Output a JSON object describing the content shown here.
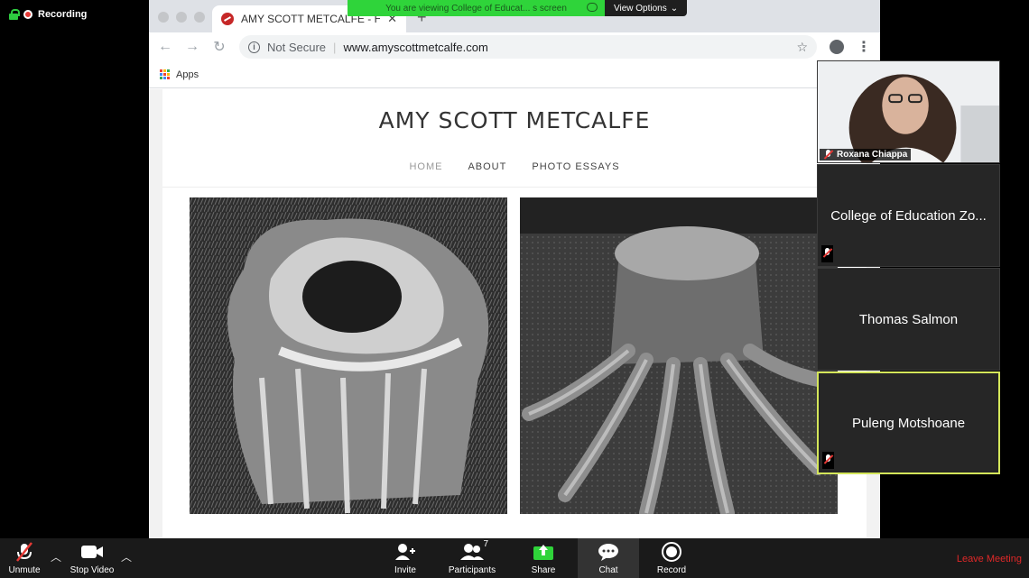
{
  "recording": {
    "label": "Recording"
  },
  "browser": {
    "tab_title": "AMY SCOTT METCALFE - Hom",
    "tab_close": "✕",
    "new_tab": "+",
    "security": "Not Secure",
    "url": "www.amyscottmetcalfe.com",
    "bookmarks": {
      "apps_label": "Apps"
    }
  },
  "site": {
    "title": "AMY SCOTT METCALFE",
    "nav": [
      {
        "label": "HOME",
        "active": true
      },
      {
        "label": "ABOUT"
      },
      {
        "label": "PHOTO ESSAYS"
      }
    ]
  },
  "share_banner": {
    "viewing_text": "You are viewing College of Educat... s screen",
    "view_options": "View Options"
  },
  "participants": [
    {
      "name": "Roxana Chiappa",
      "video": true,
      "muted": true
    },
    {
      "name": "College of Education Zo...",
      "video": false,
      "muted": true
    },
    {
      "name": "Thomas Salmon",
      "video": false,
      "muted": false
    },
    {
      "name": "Puleng Motshoane",
      "video": false,
      "muted": true,
      "active_speaker": true
    }
  ],
  "zoom_toolbar": {
    "unmute": "Unmute",
    "stop_video": "Stop Video",
    "invite": "Invite",
    "participants": "Participants",
    "participant_count": "7",
    "share": "Share",
    "chat": "Chat",
    "record": "Record",
    "leave": "Leave Meeting"
  },
  "colors": {
    "share_green": "#2fd43a",
    "active_speaker_border": "#d4e65a",
    "leave_red": "#e02828",
    "share_icon_green": "#2fd43a"
  }
}
